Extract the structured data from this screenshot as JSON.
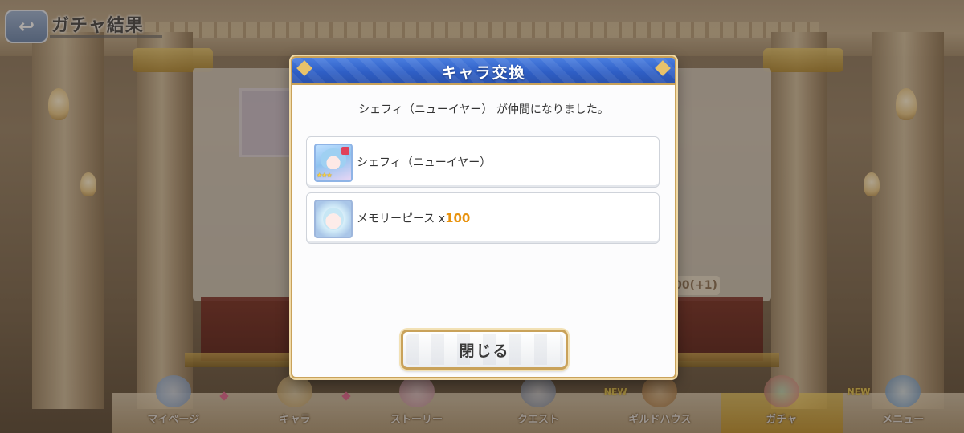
{
  "header": {
    "back_icon": "undo-arrow-icon",
    "title": "ガチャ結果"
  },
  "background": {
    "counter_text": "00(+1)"
  },
  "dialog": {
    "title": "キャラ交換",
    "message": "シェフィ（ニューイヤー） が仲間になりました。",
    "rewards": [
      {
        "icon": "character-portrait-icon",
        "name": "シェフィ（ニューイヤー）",
        "qty_prefix": "",
        "qty": ""
      },
      {
        "icon": "memory-piece-icon",
        "name": "メモリーピース",
        "qty_prefix": "x",
        "qty": "100"
      }
    ],
    "close_label": "閉じる"
  },
  "bottom_nav": {
    "items": [
      {
        "label": "マイページ",
        "new": "",
        "active": false
      },
      {
        "label": "キャラ",
        "new": "",
        "active": false
      },
      {
        "label": "ストーリー",
        "new": "",
        "active": false
      },
      {
        "label": "クエスト",
        "new": "",
        "active": false
      },
      {
        "label": "ギルドハウス",
        "new": "NEW",
        "active": false
      },
      {
        "label": "ガチャ",
        "new": "",
        "active": true
      },
      {
        "label": "メニュー",
        "new": "NEW",
        "active": false
      }
    ]
  },
  "colors": {
    "header_blue": "#2f5fc6",
    "gold_border": "#c9a25a",
    "quantity_orange": "#e8920d"
  }
}
